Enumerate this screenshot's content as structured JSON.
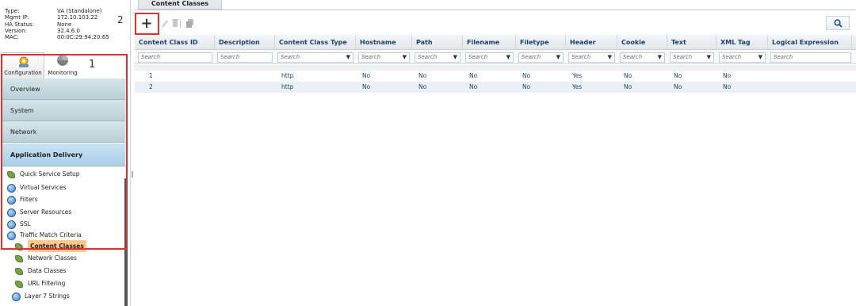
{
  "system_info": {
    "rows": [
      {
        "key": "Type:",
        "value": "VA (Standalone)"
      },
      {
        "key": "Mgmt IP:",
        "value": "172.10.103.22"
      },
      {
        "key": "HA Status:",
        "value": "None"
      },
      {
        "key": "Version:",
        "value": "32.4.6.0"
      },
      {
        "key": "MAC:",
        "value": "00:0C:29:94:20:65"
      }
    ]
  },
  "annotations": {
    "badge_1": "1",
    "badge_2": "2"
  },
  "mode_tabs": {
    "configuration": "Configuration",
    "monitoring": "Monitoring"
  },
  "accordion": {
    "overview": "Overview",
    "system": "System",
    "network": "Network",
    "application_delivery": "Application Delivery"
  },
  "tree": {
    "items": [
      {
        "label": "Quick Service Setup",
        "icon": "leaf-icon"
      },
      {
        "label": "Virtual Services",
        "icon": "globe-icon"
      },
      {
        "label": "Filters",
        "icon": "globe-icon"
      },
      {
        "label": "Server Resources",
        "icon": "globe-icon"
      },
      {
        "label": "SSL",
        "icon": "globe-icon"
      },
      {
        "label": "Traffic Match Criteria",
        "icon": "globe-icon"
      },
      {
        "label": "Content Classes",
        "icon": "leaf-icon",
        "selected": true
      },
      {
        "label": "Network Classes",
        "icon": "leaf-icon"
      },
      {
        "label": "Data Classes",
        "icon": "leaf-icon"
      },
      {
        "label": "URL Filtering",
        "icon": "leaf-icon"
      },
      {
        "label": "Layer 7 Strings",
        "icon": "globe-icon"
      }
    ]
  },
  "page": {
    "title_tab": "Content Classes"
  },
  "toolbar": {
    "add_label": "+",
    "search_icon": "search-icon"
  },
  "grid": {
    "columns": [
      "Content Class ID",
      "Description",
      "Content Class Type",
      "Hostname",
      "Path",
      "Filename",
      "Filetype",
      "Header",
      "Cookie",
      "Text",
      "XML Tag",
      "Logical Expression"
    ],
    "filter_placeholder": "Search",
    "rows": [
      [
        "1",
        "",
        "http",
        "No",
        "No",
        "No",
        "No",
        "Yes",
        "No",
        "No",
        "No",
        ""
      ],
      [
        "2",
        "",
        "http",
        "No",
        "No",
        "No",
        "No",
        "Yes",
        "No",
        "No",
        "No",
        ""
      ]
    ]
  },
  "colors": {
    "highlight_box": "#e03030",
    "selected_item": "#ffc88a",
    "header_text": "#1f3f66"
  }
}
